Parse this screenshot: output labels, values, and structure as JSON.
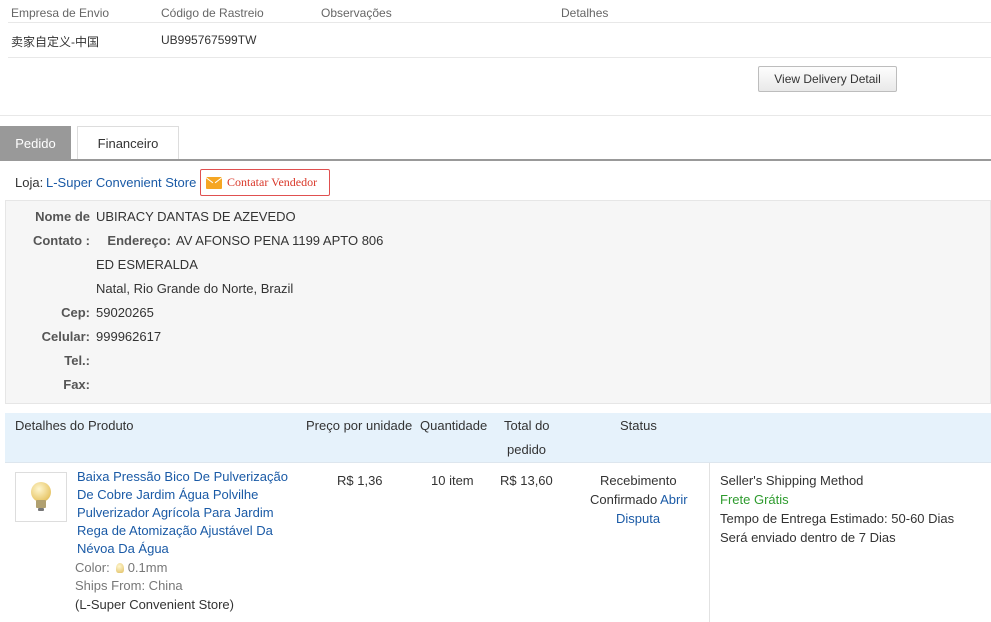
{
  "shipping": {
    "headers": [
      "Empresa de Envio",
      "Código de Rastreio",
      "Observações",
      "Detalhes"
    ],
    "company": "卖家自定义-中国",
    "tracking_code": "UB995767599TW",
    "view_delivery_label": "View Delivery Detail"
  },
  "tabs": [
    {
      "label": "Pedido",
      "active": true
    },
    {
      "label": "Financeiro",
      "active": false
    }
  ],
  "store": {
    "label": "Loja:",
    "name": "L-Super Convenient Store",
    "contact_label": "Contatar Vendedor"
  },
  "address": {
    "name_label": "Nome de",
    "name": "UBIRACY DANTAS DE AZEVEDO",
    "contact_label": "Contato :",
    "street_label": "Endereço:",
    "street": "AV AFONSO PENA 1199 APTO 806",
    "line2": "ED ESMERALDA",
    "line3": "Natal, Rio Grande do Norte, Brazil",
    "cep_label": "Cep:",
    "cep": "59020265",
    "celular_label": "Celular:",
    "celular": "999962617",
    "tel_label": "Tel.:",
    "fax_label": "Fax:"
  },
  "table": {
    "headers": {
      "product": "Detalhes do Produto",
      "unit_price": "Preço por unidade",
      "quantity": "Quantidade",
      "total_line1": "Total do",
      "total_line2": "pedido",
      "status": "Status"
    }
  },
  "product": {
    "title": "Baixa Pressão Bico De Pulverização De Cobre Jardim Água Polvilhe Pulverizador Agrícola Para Jardim Rega de Atomização Ajustável Da Névoa Da Água",
    "color_label": "Color:",
    "color_value": "0.1mm",
    "ships_from": "Ships From: China",
    "store_note": "(L-Super Convenient Store)",
    "unit_price": "R$ 1,36",
    "quantity": "10 item",
    "total": "R$ 13,60",
    "status_line1": "Recebimento",
    "status_line2": "Confirmado",
    "dispute_part1": "Abrir",
    "dispute_part2": "Disputa",
    "shipping_method": "Seller's Shipping Method",
    "free_shipping": "Frete Grátis",
    "delivery_estimate_label": "Tempo de Entrega Estimado:",
    "delivery_estimate": "50-60 Dias",
    "dispatch": "Será enviado dentro de 7 Dias"
  }
}
